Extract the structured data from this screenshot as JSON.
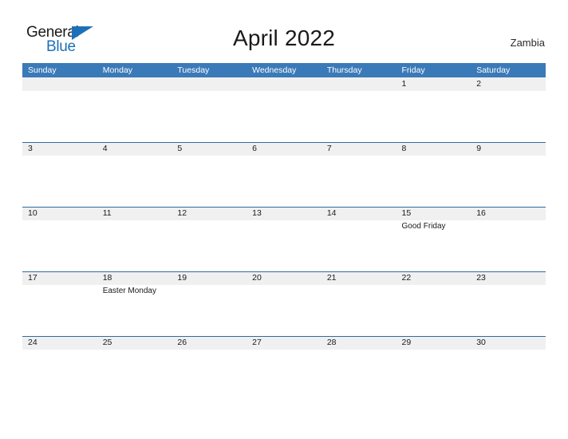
{
  "brand": {
    "name_part1": "General",
    "name_part2": "Blue",
    "accent_color": "#1d70b8"
  },
  "header": {
    "title": "April 2022",
    "country": "Zambia"
  },
  "theme": {
    "header_blue": "#3b7ab8",
    "band_gray": "#f0f0f0",
    "rule_blue": "#2e6da4",
    "text_dark": "#1a1a1a"
  },
  "calendar": {
    "weekdays": [
      "Sunday",
      "Monday",
      "Tuesday",
      "Wednesday",
      "Thursday",
      "Friday",
      "Saturday"
    ],
    "weeks": [
      [
        {
          "day": ""
        },
        {
          "day": ""
        },
        {
          "day": ""
        },
        {
          "day": ""
        },
        {
          "day": ""
        },
        {
          "day": "1",
          "event": ""
        },
        {
          "day": "2",
          "event": ""
        }
      ],
      [
        {
          "day": "3",
          "event": ""
        },
        {
          "day": "4",
          "event": ""
        },
        {
          "day": "5",
          "event": ""
        },
        {
          "day": "6",
          "event": ""
        },
        {
          "day": "7",
          "event": ""
        },
        {
          "day": "8",
          "event": ""
        },
        {
          "day": "9",
          "event": ""
        }
      ],
      [
        {
          "day": "10",
          "event": ""
        },
        {
          "day": "11",
          "event": ""
        },
        {
          "day": "12",
          "event": ""
        },
        {
          "day": "13",
          "event": ""
        },
        {
          "day": "14",
          "event": ""
        },
        {
          "day": "15",
          "event": "Good Friday"
        },
        {
          "day": "16",
          "event": ""
        }
      ],
      [
        {
          "day": "17",
          "event": ""
        },
        {
          "day": "18",
          "event": "Easter Monday"
        },
        {
          "day": "19",
          "event": ""
        },
        {
          "day": "20",
          "event": ""
        },
        {
          "day": "21",
          "event": ""
        },
        {
          "day": "22",
          "event": ""
        },
        {
          "day": "23",
          "event": ""
        }
      ],
      [
        {
          "day": "24",
          "event": ""
        },
        {
          "day": "25",
          "event": ""
        },
        {
          "day": "26",
          "event": ""
        },
        {
          "day": "27",
          "event": ""
        },
        {
          "day": "28",
          "event": ""
        },
        {
          "day": "29",
          "event": ""
        },
        {
          "day": "30",
          "event": ""
        }
      ]
    ]
  }
}
